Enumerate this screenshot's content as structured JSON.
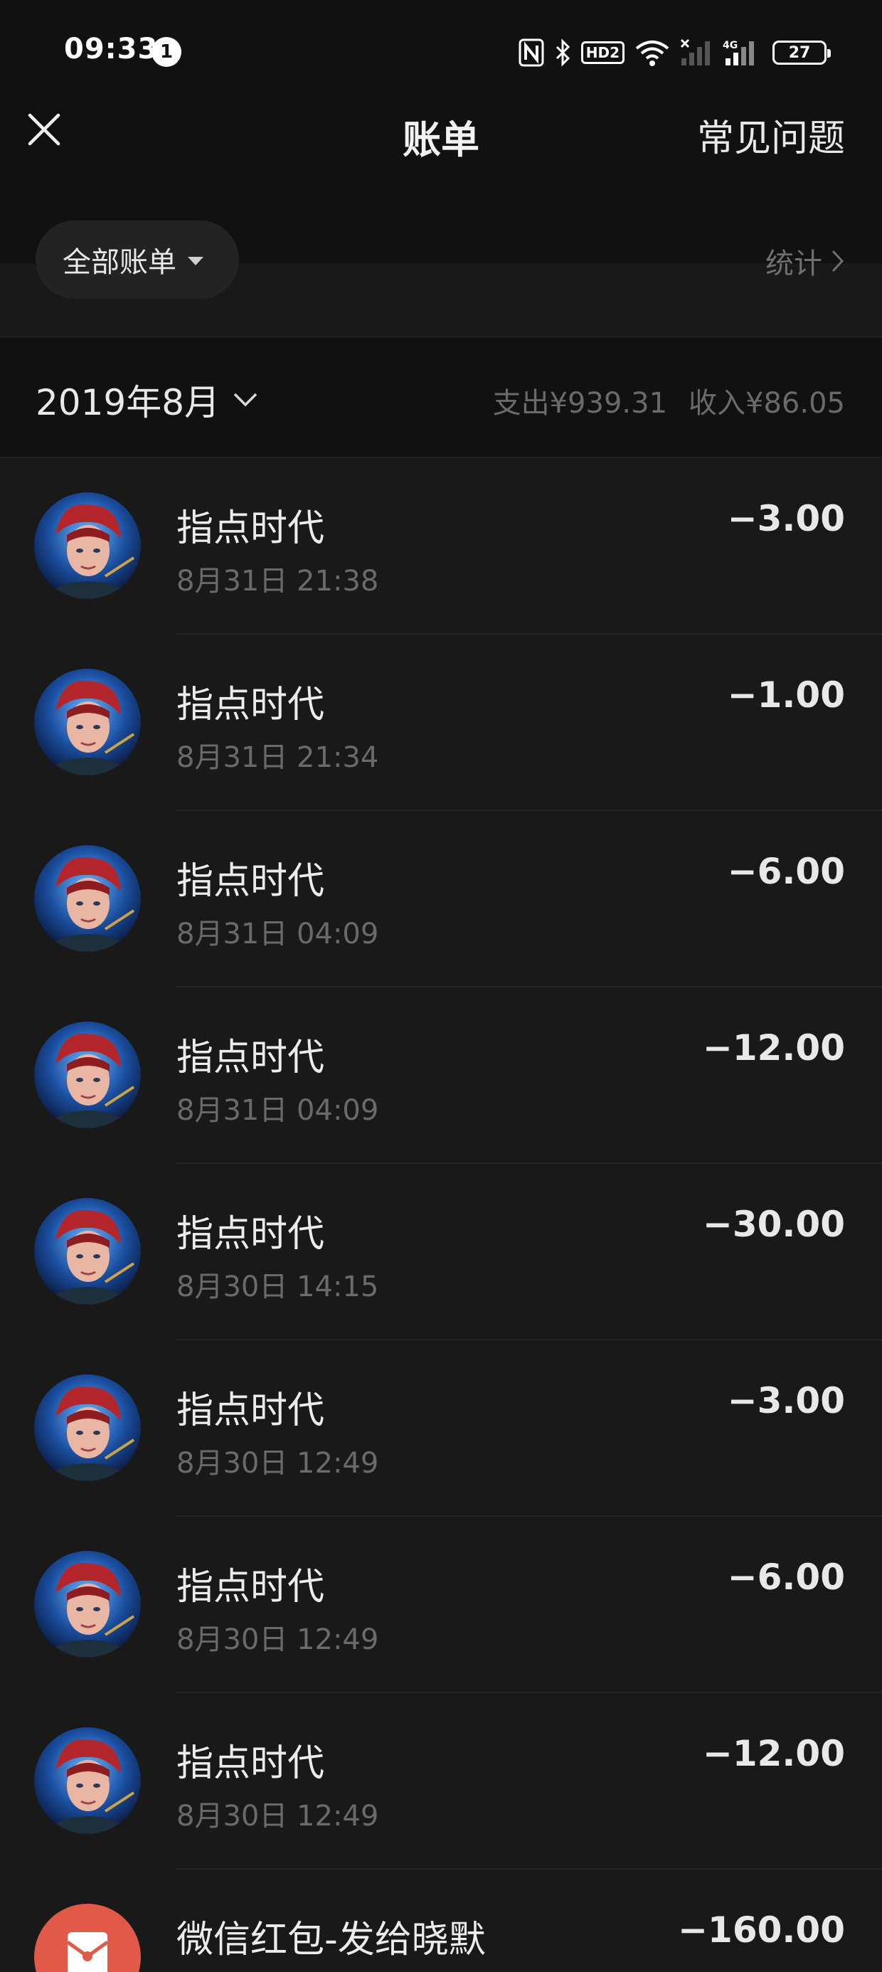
{
  "status_bar": {
    "time": "09:33",
    "notification_count": "1",
    "hd_label": "HD2",
    "network_label": "4G",
    "battery": "27"
  },
  "header": {
    "title": "账单",
    "faq_label": "常见问题"
  },
  "filter": {
    "label": "全部账单",
    "stats_label": "统计"
  },
  "month": {
    "label": "2019年8月",
    "expense": "支出¥939.31",
    "income": "收入¥86.05"
  },
  "transactions": [
    {
      "name": "指点时代",
      "time": "8月31日 21:38",
      "amount": "−3.00",
      "icon": "game-avatar"
    },
    {
      "name": "指点时代",
      "time": "8月31日 21:34",
      "amount": "−1.00",
      "icon": "game-avatar"
    },
    {
      "name": "指点时代",
      "time": "8月31日 04:09",
      "amount": "−6.00",
      "icon": "game-avatar"
    },
    {
      "name": "指点时代",
      "time": "8月31日 04:09",
      "amount": "−12.00",
      "icon": "game-avatar"
    },
    {
      "name": "指点时代",
      "time": "8月30日 14:15",
      "amount": "−30.00",
      "icon": "game-avatar"
    },
    {
      "name": "指点时代",
      "time": "8月30日 12:49",
      "amount": "−3.00",
      "icon": "game-avatar"
    },
    {
      "name": "指点时代",
      "time": "8月30日 12:49",
      "amount": "−6.00",
      "icon": "game-avatar"
    },
    {
      "name": "指点时代",
      "time": "8月30日 12:49",
      "amount": "−12.00",
      "icon": "game-avatar"
    },
    {
      "name": "微信红包-发给晓默",
      "time": "",
      "amount": "−160.00",
      "icon": "red-packet-icon"
    }
  ],
  "colors": {
    "background": "#191919",
    "header_bg": "#111111",
    "red_packet": "#e15a47"
  }
}
